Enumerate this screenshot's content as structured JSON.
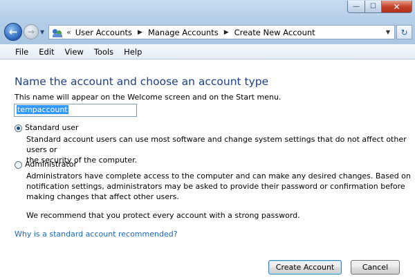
{
  "window": {
    "minimize_glyph": "—",
    "maximize_glyph": "☐",
    "close_glyph": "✕"
  },
  "nav": {
    "back_glyph": "←",
    "forward_glyph": "→",
    "history_glyph": "▼",
    "address_chevron": "«",
    "breadcrumbs": [
      "User Accounts",
      "Manage Accounts",
      "Create New Account"
    ],
    "breadcrumb_separator": "▶",
    "address_dropdown_glyph": "▼",
    "refresh_glyph": "↻"
  },
  "menu": [
    "File",
    "Edit",
    "View",
    "Tools",
    "Help"
  ],
  "content": {
    "heading": "Name the account and choose an account type",
    "subtext": "This name will appear on the Welcome screen and on the Start menu.",
    "account_name_value": "tempaccount",
    "options": [
      {
        "label": "Standard user",
        "checked": true,
        "description_lines": [
          "Standard account users can use most software and change system settings that do not affect other users or",
          "the security of the computer."
        ]
      },
      {
        "label": "Administrator",
        "checked": false,
        "description_lines": [
          "Administrators have complete access to the computer and can make any desired changes. Based on",
          "notification settings, administrators may be asked to provide their password or confirmation before",
          "making changes that affect other users."
        ]
      }
    ],
    "recommendation": "We recommend that you protect every account with a strong password.",
    "help_link": "Why is a standard account recommended?"
  },
  "buttons": {
    "create": "Create Account",
    "cancel": "Cancel"
  },
  "colors": {
    "heading": "#1e3f8a",
    "link": "#1a66c4",
    "selection": "#3399ff"
  }
}
